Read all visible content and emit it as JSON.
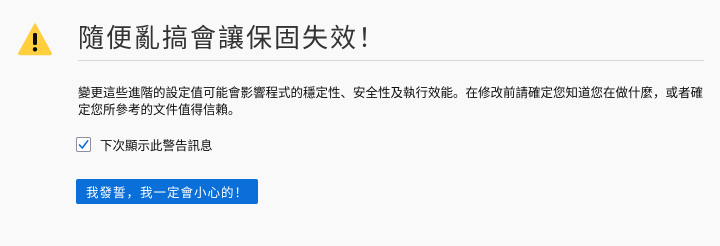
{
  "warning": {
    "icon": "warning-triangle-icon",
    "title": "隨便亂搞會讓保固失效！"
  },
  "description": "變更這些進階的設定值可能會影響程式的穩定性、安全性及執行效能。在修改前請確定您知道您在做什麼，或者確定您所參考的文件值得信賴。",
  "checkbox": {
    "label": "下次顯示此警告訊息",
    "checked": true
  },
  "accept_button": {
    "label": "我發誓，我一定會小心的！"
  },
  "colors": {
    "accent": "#0a6fd8",
    "warning": "#ffcf3e",
    "background": "#f9f9fa"
  }
}
